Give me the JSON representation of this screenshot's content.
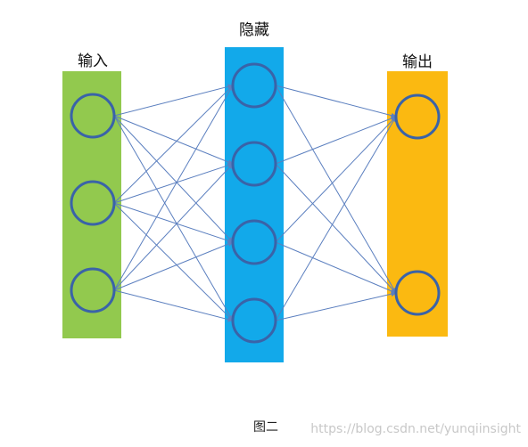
{
  "layers": [
    {
      "id": "input",
      "label": "输入",
      "color": "#92c94e",
      "node_count": 3
    },
    {
      "id": "hidden",
      "label": "隐藏",
      "color": "#12a9ea",
      "node_count": 4
    },
    {
      "id": "output",
      "label": "输出",
      "color": "#fbb911",
      "node_count": 2
    }
  ],
  "colors": {
    "node_stroke": "#3a63a8",
    "edge": "#5b7fbf"
  },
  "caption": "图二",
  "watermark": "https://blog.csdn.net/yunqiinsight"
}
